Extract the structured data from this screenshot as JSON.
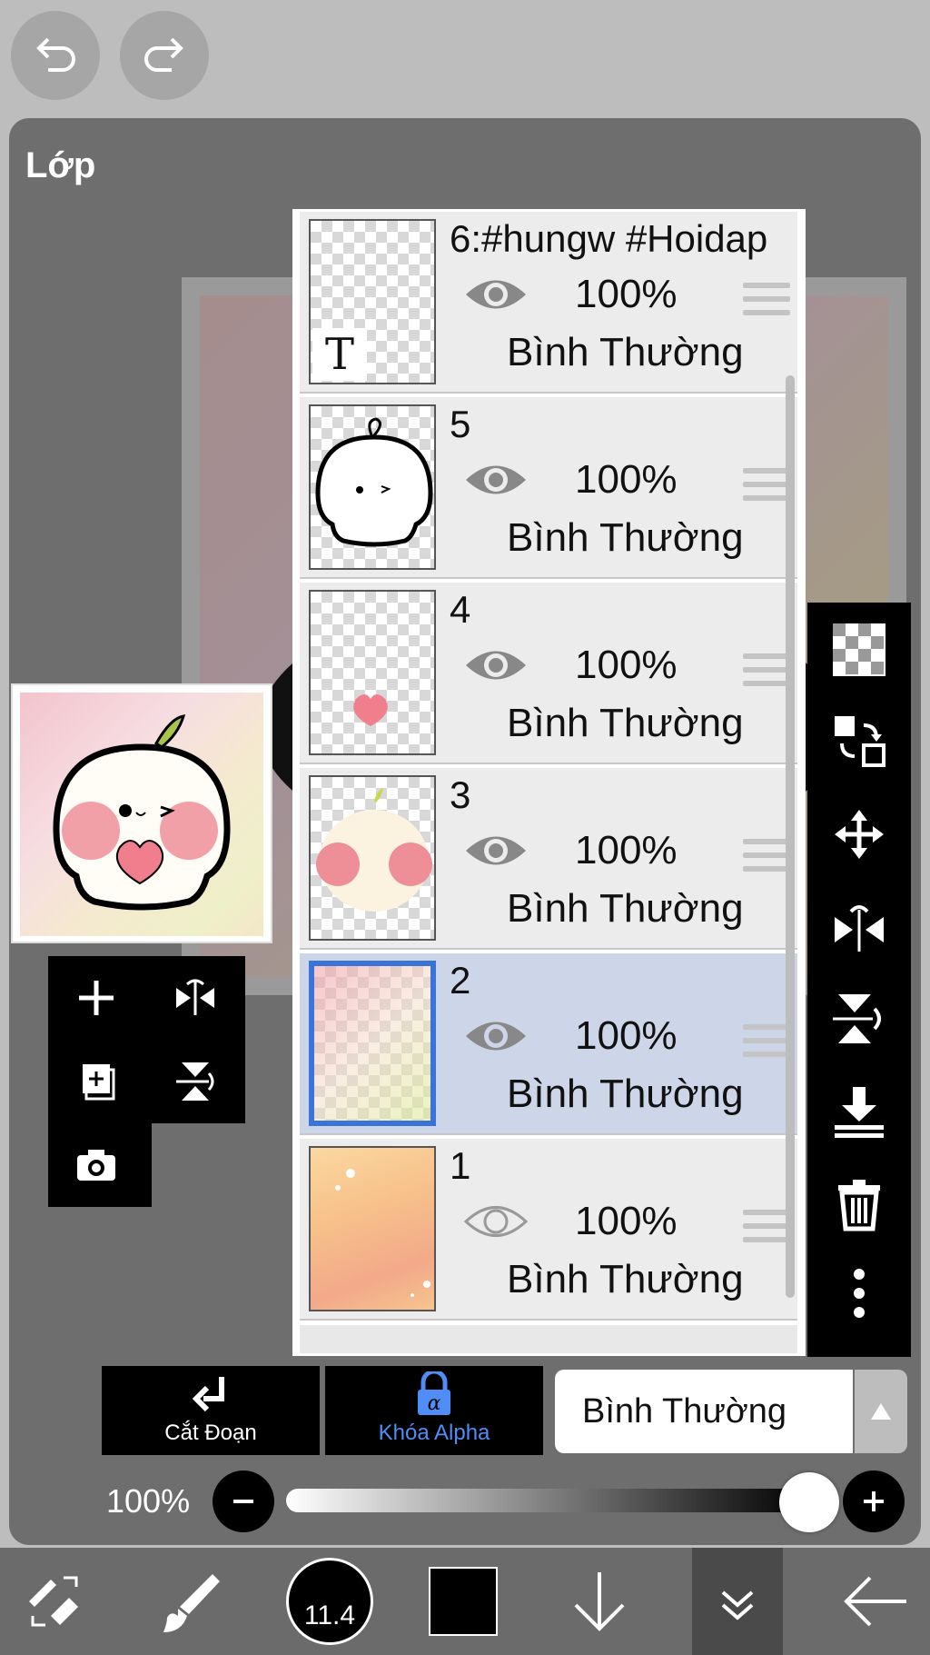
{
  "title": "Lớp",
  "layers": [
    {
      "name": "6:#hungw #Hoidap",
      "opacity": "100%",
      "mode": "Bình Thường",
      "visible": true,
      "thumb_label": "T"
    },
    {
      "name": "5",
      "opacity": "100%",
      "mode": "Bình Thường",
      "visible": true
    },
    {
      "name": "4",
      "opacity": "100%",
      "mode": "Bình Thường",
      "visible": true
    },
    {
      "name": "3",
      "opacity": "100%",
      "mode": "Bình Thường",
      "visible": true
    },
    {
      "name": "2",
      "opacity": "100%",
      "mode": "Bình Thường",
      "visible": true,
      "selected": true
    },
    {
      "name": "1",
      "opacity": "100%",
      "mode": "Bình Thường",
      "visible": false
    }
  ],
  "buttons": {
    "clip": "Cắt Đoạn",
    "alpha_lock": "Khóa Alpha",
    "blend_mode": "Bình Thường"
  },
  "opacity_slider": {
    "label": "100%",
    "value": 1.0
  },
  "toolbar": {
    "brush_size": "11.4"
  },
  "colors": {
    "selected_layer": "#ccd6e8",
    "selection_border": "#3a74d8",
    "alpha_lock_accent": "#4f8df7"
  }
}
